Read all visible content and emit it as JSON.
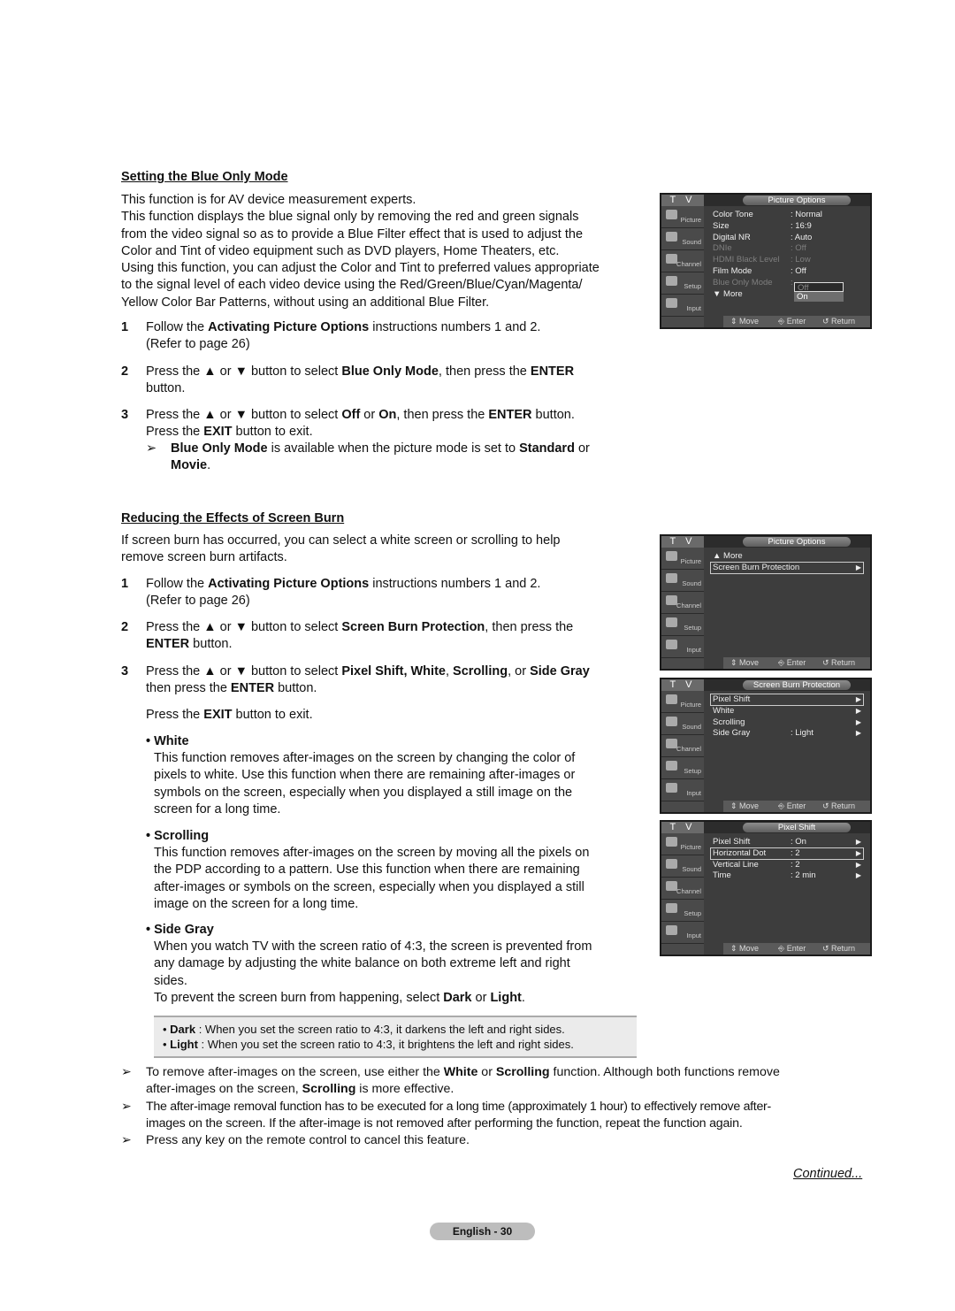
{
  "blue_only": {
    "heading": "Setting the Blue Only Mode",
    "intro_lines": [
      "This function is for AV device measurement experts.",
      "This function displays the blue signal only by removing the red and green signals",
      "from the video signal so as to provide a Blue Filter effect that is used to adjust the",
      "Color and Tint of video equipment such as DVD players, Home Theaters, etc.",
      "Using this function, you can adjust the Color and Tint to preferred values appropriate",
      "to the signal level of each video device using the Red/Green/Blue/Cyan/Magenta/",
      "Yellow Color Bar Patterns, without using an additional Blue Filter."
    ],
    "steps": [
      {
        "num": "1",
        "line1_pre": "Follow the ",
        "line1_bold": "Activating Picture Options",
        "line1_post": " instructions numbers 1 and 2.",
        "line2": "(Refer to page 26)"
      },
      {
        "num": "2",
        "line1_pre": "Press the ▲ or ▼ button to select ",
        "line1_bold": "Blue Only Mode",
        "line1_mid": ", then press the ",
        "line1_bold2": "ENTER",
        "line2": "button."
      },
      {
        "num": "3",
        "line1_pre": "Press the ▲ or ▼ button to select ",
        "line1_bold": "Off",
        "line1_mid": " or ",
        "line1_bold2": "On",
        "line1_mid2": ", then press the ",
        "line1_bold3": "ENTER",
        "line1_post": " button.",
        "line2_pre": "Press the ",
        "line2_bold": "EXIT",
        "line2_post": " button to exit."
      }
    ],
    "note": {
      "arrow": "➢",
      "bold1": "Blue Only Mode",
      "mid": " is available when the picture mode is set to ",
      "bold2": "Standard",
      "post": " or",
      "bold3": "Movie",
      "end": "."
    }
  },
  "screen_burn": {
    "heading": "Reducing the Effects of Screen Burn",
    "intro_lines": [
      "If screen burn has occurred, you can select a white screen or scrolling to help",
      "remove screen burn artifacts."
    ],
    "steps": [
      {
        "num": "1",
        "line1_pre": "Follow the ",
        "line1_bold": "Activating Picture Options",
        "line1_post": " instructions numbers 1 and 2.",
        "line2": "(Refer to page 26)"
      },
      {
        "num": "2",
        "line1_pre": "Press the ▲ or ▼ button to select ",
        "line1_bold": "Screen Burn Protection",
        "line1_post": ", then press the",
        "line2_bold": "ENTER",
        "line2_post": " button."
      },
      {
        "num": "3",
        "line1_pre": "Press the ▲ or ▼ button to select ",
        "line1_bold": "Pixel Shift, White",
        "line1_mid": ", ",
        "line1_bold2": "Scrolling",
        "line1_mid2": ", or ",
        "line1_bold3": "Side Gray",
        "line2_pre": "then press the ",
        "line2_bold": "ENTER",
        "line2_post": " button.",
        "line3_pre": "Press the ",
        "line3_bold": "EXIT",
        "line3_post": " button to exit."
      }
    ],
    "bullets": [
      {
        "title": "• White",
        "lines": [
          "This function removes after-images on the screen by changing the color of",
          "pixels to white. Use this function when there are remaining after-images or",
          "symbols on the screen, especially when you displayed a still image on the",
          "screen for a long time."
        ]
      },
      {
        "title": "• Scrolling",
        "lines": [
          "This function removes after-images on the screen by moving all the pixels on",
          "the PDP according to a pattern. Use this function when there are remaining",
          "after-images or symbols on the screen, especially when you displayed a still",
          "image on the screen for a long time."
        ]
      },
      {
        "title": "• Side Gray",
        "lines": [
          "When you watch TV with the screen ratio of 4:3, the screen is prevented from",
          "any damage by adjusting the white balance on both extreme left and right",
          "sides."
        ],
        "last_pre": "To prevent the screen burn from happening, select ",
        "last_bold1": "Dark",
        "last_mid": " or ",
        "last_bold2": "Light",
        "last_end": "."
      }
    ],
    "grey_box": [
      {
        "bullet": "• ",
        "bold": "Dark",
        "text": " : When you set the screen ratio to 4:3, it darkens the left and right sides."
      },
      {
        "bullet": "• ",
        "bold": "Light",
        "text": " : When you set the screen ratio to 4:3, it brightens the left and right sides."
      }
    ],
    "notes": [
      {
        "arrow": "➢",
        "pre": "To remove after-images on the screen, use either the ",
        "bold1": "White",
        "mid": " or ",
        "bold2": "Scrolling",
        "post": " function. Although both functions remove",
        "line2_pre": "after-images on the screen, ",
        "line2_bold": "Scrolling",
        "line2_post": " is more effective."
      },
      {
        "arrow": "➢",
        "pre": "The after-image removal function has to be executed for a long time (approximately 1 hour) to effectively remove after-",
        "line2_pre": "images on the screen. If the after-image is not removed after performing the function, repeat the function again."
      },
      {
        "arrow": "➢",
        "pre": "Press any key on the remote control to cancel this feature."
      }
    ]
  },
  "osd_common": {
    "tv_label": "T V",
    "sidebar": [
      "Picture",
      "Sound",
      "Channel",
      "Setup",
      "Input"
    ],
    "footer": {
      "move": "⇕ Move",
      "enter": "⎆ Enter",
      "return": "↺ Return"
    }
  },
  "osd_screens": [
    {
      "title": "Picture Options",
      "rows": [
        {
          "key": "Color Tone",
          "value": ": Normal"
        },
        {
          "key": "Size",
          "value": ": 16:9"
        },
        {
          "key": "Digital NR",
          "value": ": Auto"
        },
        {
          "key": "DNIe",
          "value": ": Off",
          "dim": true
        },
        {
          "key": "HDMI Black Level",
          "value": ": Low",
          "dim": true
        },
        {
          "key": "Film Mode",
          "value": ": Off"
        },
        {
          "key": "Blue Only Mode",
          "value": ":",
          "dim": true
        },
        {
          "key": "▼ More",
          "value": ""
        }
      ],
      "dropdown": [
        "Off",
        "On"
      ],
      "dropdown_selected": "Off"
    },
    {
      "title": "Picture Options",
      "rows": [
        {
          "key": "▲ More",
          "value": ""
        },
        {
          "key": "Screen Burn Protection",
          "value": "",
          "arrow": "▶",
          "selected": true
        }
      ]
    },
    {
      "title": "Screen Burn Protection",
      "rows": [
        {
          "key": "Pixel Shift",
          "value": "",
          "arrow": "▶",
          "selected": true
        },
        {
          "key": "White",
          "value": "",
          "arrow": "▶"
        },
        {
          "key": "Scrolling",
          "value": "",
          "arrow": "▶"
        },
        {
          "key": "Side Gray",
          "value": ": Light",
          "arrow": "▶"
        }
      ]
    },
    {
      "title": "Pixel Shift",
      "rows": [
        {
          "key": "Pixel Shift",
          "value": ": On",
          "arrow": "▶"
        },
        {
          "key": "Horizontal Dot",
          "value": ": 2",
          "arrow": "▶",
          "selected": true
        },
        {
          "key": "Vertical Line",
          "value": ": 2",
          "arrow": "▶"
        },
        {
          "key": "Time",
          "value": ": 2 min",
          "arrow": "▶"
        }
      ]
    }
  ],
  "footer": {
    "continued": "Continued...",
    "page": "English - 30"
  }
}
